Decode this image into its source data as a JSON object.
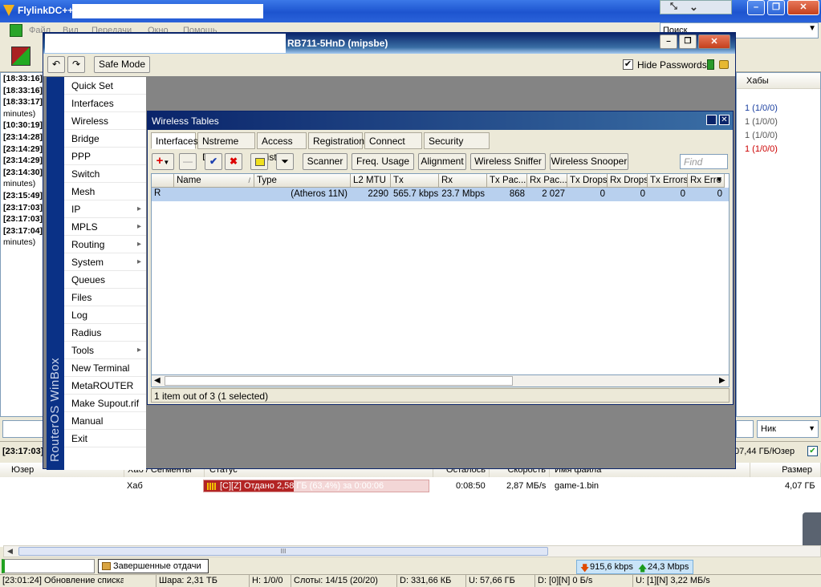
{
  "flylink": {
    "title": "FlylinkDC++",
    "menu": [
      "Файл",
      "Вид",
      "Передачи",
      "Окно",
      "Помощь"
    ],
    "search_placeholder": "Поиск",
    "hubs_header": "Хабы",
    "hub_counts": [
      {
        "text": "1 (1/0/0)",
        "color": "#1a3fa0"
      },
      {
        "text": "1 (1/0/0)",
        "color": "#555555"
      },
      {
        "text": "1 (1/0/0)",
        "color": "#555555"
      },
      {
        "text": "1 (1/0/0)",
        "color": "#cc0000"
      }
    ],
    "chat": [
      "[18:33:16]",
      "[18:33:16]",
      "[18:33:17]",
      "minutes)",
      "[10:30:19]",
      "[23:14:28]",
      "[23:14:29]",
      "[23:14:29]",
      "[23:14:30]",
      "minutes)",
      "[23:15:49]",
      "[23:17:03]",
      "[23:17:03]",
      "[23:17:04]",
      "minutes)"
    ],
    "nick_select": "Ник",
    "chat_status_time": "[23:17:03]",
    "share_per_user": "07,44 ГБ/Юзер",
    "transfers_headers": {
      "user": "Юзер",
      "hub": "Хаб / Сегменты",
      "status": "Статус",
      "remaining": "Осталось",
      "speed": "Скорость",
      "file": "Имя файла",
      "size": "Размер"
    },
    "transfer_row": {
      "hub": "Хаб",
      "status": "[C][Z] Отдано 2,58 ГБ (63,4%) за 0:00:06",
      "progress": 0.634,
      "remaining": "0:08:50",
      "speed": "2,87 МБ/s",
      "file": "game-1.bin",
      "size": "4,07 ГБ"
    },
    "scroll_grip": "III",
    "finished_tab": "Завершенные отдачи",
    "speed_down": "915,6 kbps",
    "speed_up": "24,3 Mbps",
    "status": {
      "log": "[23:01:24] Обновление списка",
      "share": "Шара: 2,31 ТБ",
      "hubs": "H: 1/0/0",
      "slots": "Слоты: 14/15 (20/20)",
      "d": "D: 331,66 КБ",
      "u": "U: 57,66 ГБ",
      "dn": "D: [0][N] 0 Б/s",
      "un": "U: [1][N] 3,22 МБ/s"
    }
  },
  "winbox": {
    "title": "RB711-5HnD (mipsbe)",
    "safe_mode": "Safe Mode",
    "hide_passwords": "Hide Passwords",
    "hide_passwords_checked": true,
    "sidebar_brand": "RouterOS WinBox",
    "menu": [
      {
        "label": "Quick Set",
        "sub": false
      },
      {
        "label": "Interfaces",
        "sub": false
      },
      {
        "label": "Wireless",
        "sub": false
      },
      {
        "label": "Bridge",
        "sub": false
      },
      {
        "label": "PPP",
        "sub": false
      },
      {
        "label": "Switch",
        "sub": false
      },
      {
        "label": "Mesh",
        "sub": false
      },
      {
        "label": "IP",
        "sub": true
      },
      {
        "label": "MPLS",
        "sub": true
      },
      {
        "label": "Routing",
        "sub": true
      },
      {
        "label": "System",
        "sub": true
      },
      {
        "label": "Queues",
        "sub": false
      },
      {
        "label": "Files",
        "sub": false
      },
      {
        "label": "Log",
        "sub": false
      },
      {
        "label": "Radius",
        "sub": false
      },
      {
        "label": "Tools",
        "sub": true
      },
      {
        "label": "New Terminal",
        "sub": false
      },
      {
        "label": "MetaROUTER",
        "sub": false
      },
      {
        "label": "Make Supout.rif",
        "sub": false
      },
      {
        "label": "Manual",
        "sub": false
      },
      {
        "label": "Exit",
        "sub": false
      }
    ]
  },
  "wireless_tables": {
    "title": "Wireless Tables",
    "tabs": [
      "Interfaces",
      "Nstreme Dual",
      "Access List",
      "Registration",
      "Connect List",
      "Security Profiles"
    ],
    "active_tab": "Interfaces",
    "buttons": [
      "Scanner",
      "Freq. Usage",
      "Alignment",
      "Wireless Sniffer",
      "Wireless Snooper"
    ],
    "find_placeholder": "Find",
    "columns": [
      "Name",
      "Type",
      "L2 MTU",
      "Tx",
      "Rx",
      "Tx Pac...",
      "Rx Pac...",
      "Tx Drops",
      "Rx Drops",
      "Tx Errors",
      "Rx Erro"
    ],
    "rows": [
      {
        "flag": "R",
        "name": "",
        "type": "(Atheros 11N)",
        "l2mtu": "2290",
        "tx": "565.7 kbps",
        "rx": "23.7 Mbps",
        "txpac": "868",
        "rxpac": "2 027",
        "txdrops": "0",
        "rxdrops": "0",
        "txerrors": "0",
        "rxerrors": "0"
      }
    ],
    "status": "1 item out of 3 (1 selected)"
  }
}
